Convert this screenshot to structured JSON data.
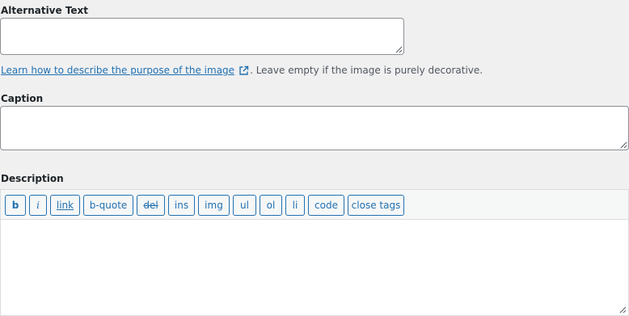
{
  "alt_text": {
    "label": "Alternative Text",
    "value": "",
    "help_link": "Learn how to describe the purpose of the image",
    "help_suffix": ". Leave empty if the image is purely decorative."
  },
  "caption": {
    "label": "Caption",
    "value": ""
  },
  "description": {
    "label": "Description",
    "value": "",
    "toolbar": [
      "b",
      "i",
      "link",
      "b-quote",
      "del",
      "ins",
      "img",
      "ul",
      "ol",
      "li",
      "code",
      "close tags"
    ]
  },
  "colors": {
    "link": "#2271b1",
    "background": "#f0f0f1",
    "border": "#8c8f94"
  },
  "icons": {
    "help_link": "external-link-icon",
    "resize": "resize-grip-icon"
  }
}
